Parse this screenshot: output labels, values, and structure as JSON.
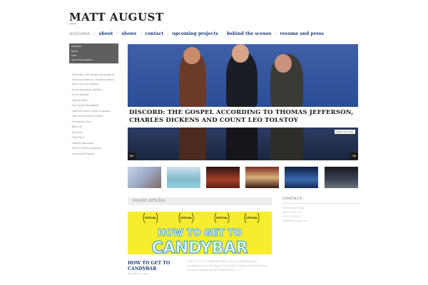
{
  "site": {
    "title": "MATT AUGUST"
  },
  "nav": [
    {
      "label": "welcome",
      "active": true
    },
    {
      "label": "about"
    },
    {
      "label": "shows"
    },
    {
      "label": "contact"
    },
    {
      "label": "upcoming projects"
    },
    {
      "label": "behind the scenes"
    },
    {
      "label": "resume and press"
    }
  ],
  "sidebar": {
    "box_links": [
      "welcome",
      "about",
      "links",
      "upcoming projects"
    ],
    "list": [
      "DISCORD: The Gospel According to",
      "Thomas Jefferson, Charles Dickens",
      "and Count Leo Tolstoy",
      "Much Ado About Nothing",
      "In the Heights",
      "Liberty Smith",
      "The Fourth Messenger",
      "How the Grinch Stole Christmas",
      "Two Gentlemen of Verona",
      "Christmas Carol",
      "Bahu Tai",
      "Pig Farm",
      "Time Flies",
      "Doenen Wounded",
      "How to Get to Candybar",
      "Upcoming Projects"
    ]
  },
  "hero": {
    "title": "DISCORD: THE GOSPEL ACCORDING TO THOMAS JEFFERSON, CHARLES DICKENS AND COUNT LEO TOLSTOY",
    "date": "March 31, 2011",
    "prev_label": "←",
    "next_label": "→"
  },
  "recent": {
    "label": "recent articles",
    "article_title": "HOW TO GET TO CANDYBAR",
    "article_date": "November 11, 2011",
    "article_excerpt": "HOW TO GET TO CANDYBAR Now in its third year at Marsh, a celebration of the members of Candy Bar's legacy. Bettina the Jotunn has been updated for the iPhone series. [...]",
    "poster_text": "HOW TO GET TO",
    "poster_big": "CANDYBAR",
    "laurel_text": "OFFICIAL SELECTION"
  },
  "contact": {
    "heading": "CONTACT:",
    "lines": [
      "Matt August Studio",
      "Beverly Hills, CA",
      "(310) 555-0142",
      "info@mattaugust.com"
    ]
  },
  "colors": {
    "nav_link": "#1c3f7a",
    "sidebar_box": "#5f5f5f",
    "hero_stage": "#2b4e95",
    "poster_yellow": "#f7ec2d"
  }
}
